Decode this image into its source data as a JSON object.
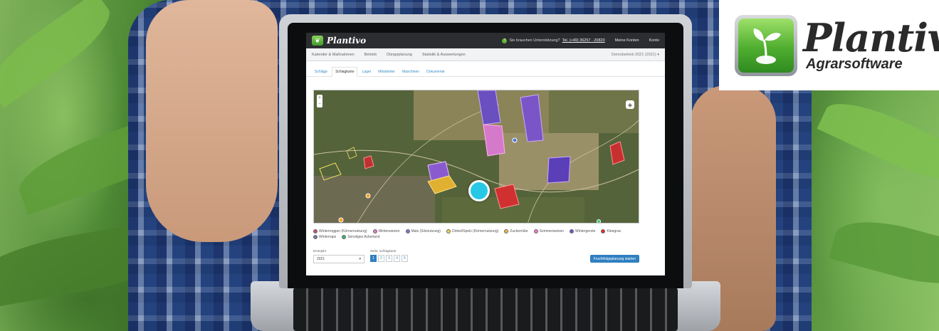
{
  "app": {
    "name": "Plantivo",
    "support_text": "Sie brauchen Unterstützung?",
    "support_phone": "Tel. (+49) 36257 - 20820",
    "top_links": [
      "Meine Konten",
      "Konto"
    ]
  },
  "main_nav": {
    "items": [
      "Kalender & Maßnahmen",
      "Betrieb",
      "Düngeplanung",
      "Statistik & Auswertungen"
    ],
    "farm_selector": "Demobetrieb 2021 (2021) ▾"
  },
  "sub_tabs": {
    "items": [
      "Schläge",
      "Schlagkarte",
      "Lager",
      "Mitarbeiter",
      "Maschinen",
      "Dokumente"
    ],
    "active_index": 1
  },
  "map": {
    "layers_icon": "layers-icon",
    "zoom_icon": "zoom-icon"
  },
  "legend": [
    {
      "label": "Winterroggen (Körnernutzung)",
      "color": "#c8507a"
    },
    {
      "label": "Winterweizen",
      "color": "#e07ad0"
    },
    {
      "label": "Mais (Silonutzung)",
      "color": "#8b6fc9"
    },
    {
      "label": "Dinkel/Spelz (Körnernutzung)",
      "color": "#f0d24a"
    },
    {
      "label": "Zuckerrübe",
      "color": "#f0b840"
    },
    {
      "label": "Sommerweizen",
      "color": "#f07ad8"
    },
    {
      "label": "Wintergerste",
      "color": "#6a5acd"
    },
    {
      "label": "Kleegras",
      "color": "#e03030"
    },
    {
      "label": "Winterraps",
      "color": "#7a7aa8"
    },
    {
      "label": "Sonstiges Ackerland",
      "color": "#3cb371"
    }
  ],
  "controls": {
    "year_label": "Erntejahr",
    "year_value": "2021",
    "pager_label": "Seite: Schlagkarte",
    "pages": [
      "1",
      "2",
      "3",
      "4",
      "5"
    ],
    "active_page": "1",
    "action_button": "Fruchtfolgeplanung starten"
  },
  "brand": {
    "name": "Plantivo",
    "subtitle": "Agrarsoftware"
  }
}
